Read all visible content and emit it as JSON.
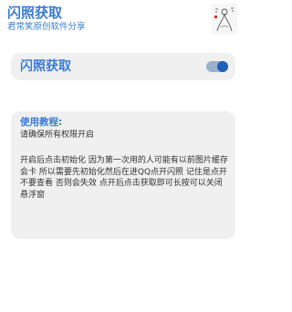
{
  "header": {
    "title": "闪照获取",
    "subtitle": "君常笑原创软件分享",
    "image_icon": "artwork-thumbnail"
  },
  "toggle_card": {
    "label": "闪照获取",
    "switch_on": true,
    "accent_color": "#3a7bd5",
    "switch_color": "#1f5fb8"
  },
  "instructions": {
    "title": "使用教程:",
    "line1": "请确保所有权限开启",
    "body": "开启后点击初始化 因为第一次用的人可能有以前图片缓存会卡 所以需要先初始化然后在进QQ点开闪照 记住是点开不要查看 否则会失效 点开后点击获取即可长按可以关闭悬浮窗"
  }
}
